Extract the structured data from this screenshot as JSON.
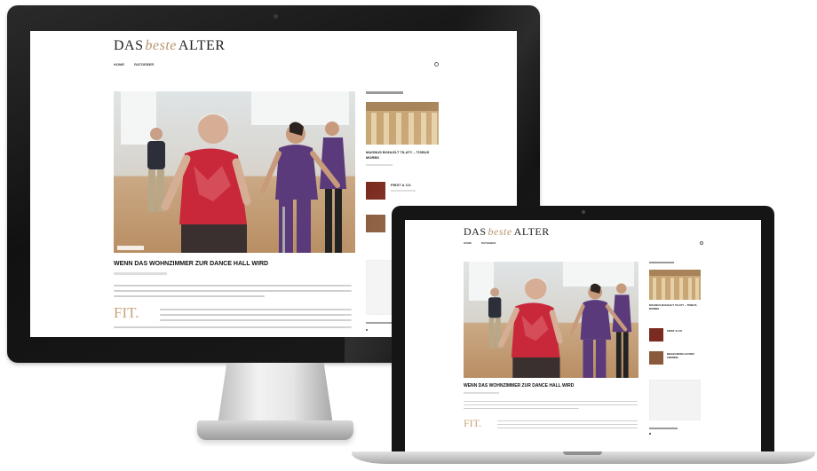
{
  "site": {
    "logo_left": "DAS",
    "logo_mid": "beste",
    "logo_right": "ALTER",
    "nav": [
      "HOME",
      "RATGEBER"
    ],
    "article": {
      "headline": "WENN DAS WOHNZIMMER ZUR DANCE HALL WIRD",
      "dropcap": "FIT."
    },
    "sidebar": {
      "first_post": "MAGNUS BOHLELT TILATY – TISBUS MORBS",
      "second_post": "FIRST & CO",
      "laptop_second_post": "FIRST & CO",
      "laptop_third_post": "BEGEGNUNG IN DER FREMDE"
    }
  },
  "colors": {
    "accent": "#b9946c",
    "dropcap": "#c7a57c",
    "shirt_red": "#c9283a",
    "shirt_purple": "#5a3a7a"
  }
}
